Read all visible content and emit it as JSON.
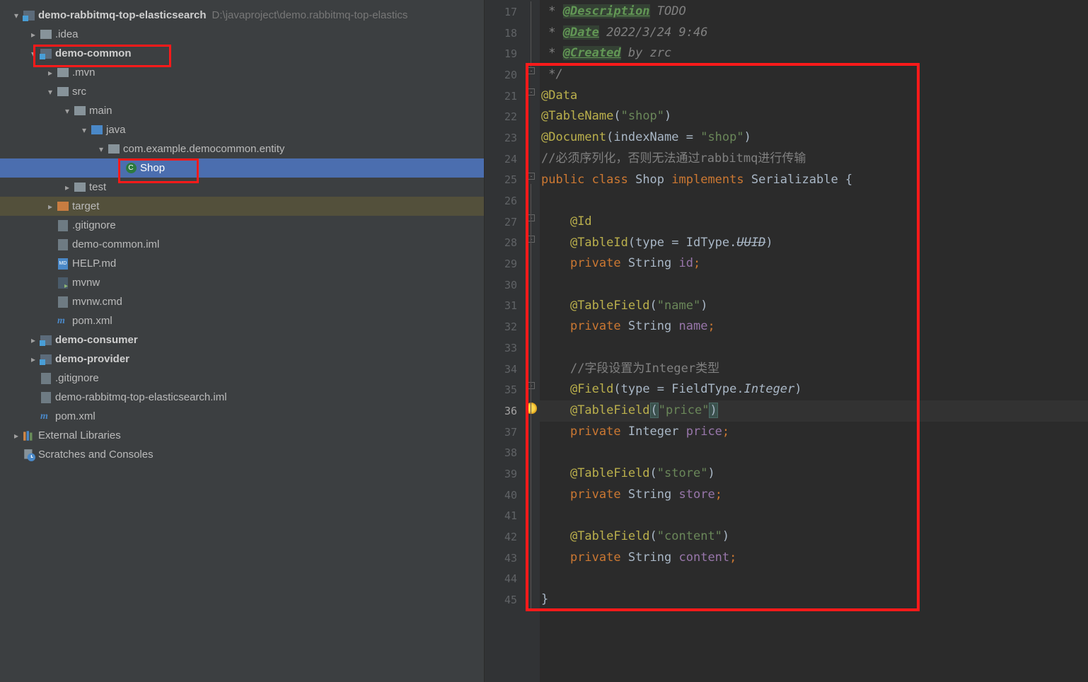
{
  "project": {
    "root_name": "demo-rabbitmq-top-elasticsearch",
    "root_path": "D:\\javaproject\\demo.rabbitmq-top-elastics",
    "nodes": {
      "idea": ".idea",
      "demo_common": "demo-common",
      "mvn": ".mvn",
      "src": "src",
      "main": "main",
      "java": "java",
      "pkg": "com.example.democommon.entity",
      "shop": "Shop",
      "test": "test",
      "target": "target",
      "gitignore": ".gitignore",
      "iml": "demo-common.iml",
      "help": "HELP.md",
      "mvnw": "mvnw",
      "mvnw_cmd": "mvnw.cmd",
      "pom": "pom.xml",
      "demo_consumer": "demo-consumer",
      "demo_provider": "demo-provider",
      "gitignore2": ".gitignore",
      "root_iml": "demo-rabbitmq-top-elasticsearch.iml",
      "pom2": "pom.xml",
      "ext_lib": "External Libraries",
      "scratch": "Scratches and Consoles"
    }
  },
  "editor": {
    "line_numbers": [
      "17",
      "18",
      "19",
      "20",
      "21",
      "22",
      "23",
      "24",
      "25",
      "26",
      "27",
      "28",
      "29",
      "30",
      "31",
      "32",
      "33",
      "34",
      "35",
      "36",
      "37",
      "38",
      "39",
      "40",
      "41",
      "42",
      "43",
      "44",
      "45"
    ],
    "current_line": "36",
    "code": {
      "l17": {
        "pre": " * ",
        "tag": "@Description",
        "rest": " TODO"
      },
      "l18": {
        "pre": " * ",
        "tag": "@Date",
        "rest": " 2022/3/24 9:46"
      },
      "l19": {
        "pre": " * ",
        "tag": "@Created",
        "rest": " by zrc"
      },
      "l20": " */",
      "l21": {
        "anno": "@Data"
      },
      "l22": {
        "anno": "@TableName",
        "paren_open": "(",
        "str": "\"shop\"",
        "paren_close": ")"
      },
      "l23": {
        "anno": "@Document",
        "paren_open": "(",
        "attr": "indexName = ",
        "str": "\"shop\"",
        "paren_close": ")"
      },
      "l24": {
        "slash": "//",
        "cn": "必须序列化，否则无法通过rabbitmq进行传输"
      },
      "l25": {
        "kw1": "public ",
        "kw2": "class ",
        "name": "Shop ",
        "kw3": "implements ",
        "type": "Serializable ",
        "brace": "{"
      },
      "l27": {
        "indent": "    ",
        "anno": "@Id"
      },
      "l28": {
        "indent": "    ",
        "anno": "@TableId",
        "open": "(",
        "attr": "type = IdType.",
        "val": "UUID",
        "close": ")"
      },
      "l29": {
        "indent": "    ",
        "kw": "private ",
        "type": "String ",
        "field": "id",
        "semi": ";"
      },
      "l31": {
        "indent": "    ",
        "anno": "@TableField",
        "open": "(",
        "str": "\"name\"",
        "close": ")"
      },
      "l32": {
        "indent": "    ",
        "kw": "private ",
        "type": "String ",
        "field": "name",
        "semi": ";"
      },
      "l34": {
        "indent": "    ",
        "slash": "//",
        "cn": "字段设置为Integer类型"
      },
      "l35": {
        "indent": "    ",
        "anno": "@Field",
        "open": "(",
        "attr": "type = FieldType.",
        "val": "Integer",
        "close": ")"
      },
      "l36": {
        "indent": "    ",
        "anno": "@TableField",
        "open": "(",
        "str": "\"price\"",
        "close": ")"
      },
      "l37": {
        "indent": "    ",
        "kw": "private ",
        "type": "Integer ",
        "field": "price",
        "semi": ";"
      },
      "l39": {
        "indent": "    ",
        "anno": "@TableField",
        "open": "(",
        "str": "\"store\"",
        "close": ")"
      },
      "l40": {
        "indent": "    ",
        "kw": "private ",
        "type": "String ",
        "field": "store",
        "semi": ";"
      },
      "l42": {
        "indent": "    ",
        "anno": "@TableField",
        "open": "(",
        "str": "\"content\"",
        "close": ")"
      },
      "l43": {
        "indent": "    ",
        "kw": "private ",
        "type": "String ",
        "field": "content",
        "semi": ";"
      },
      "l45": "}"
    }
  },
  "icons": {
    "class_letter": "C",
    "md_letter": "MD",
    "xml_letter": "m"
  }
}
